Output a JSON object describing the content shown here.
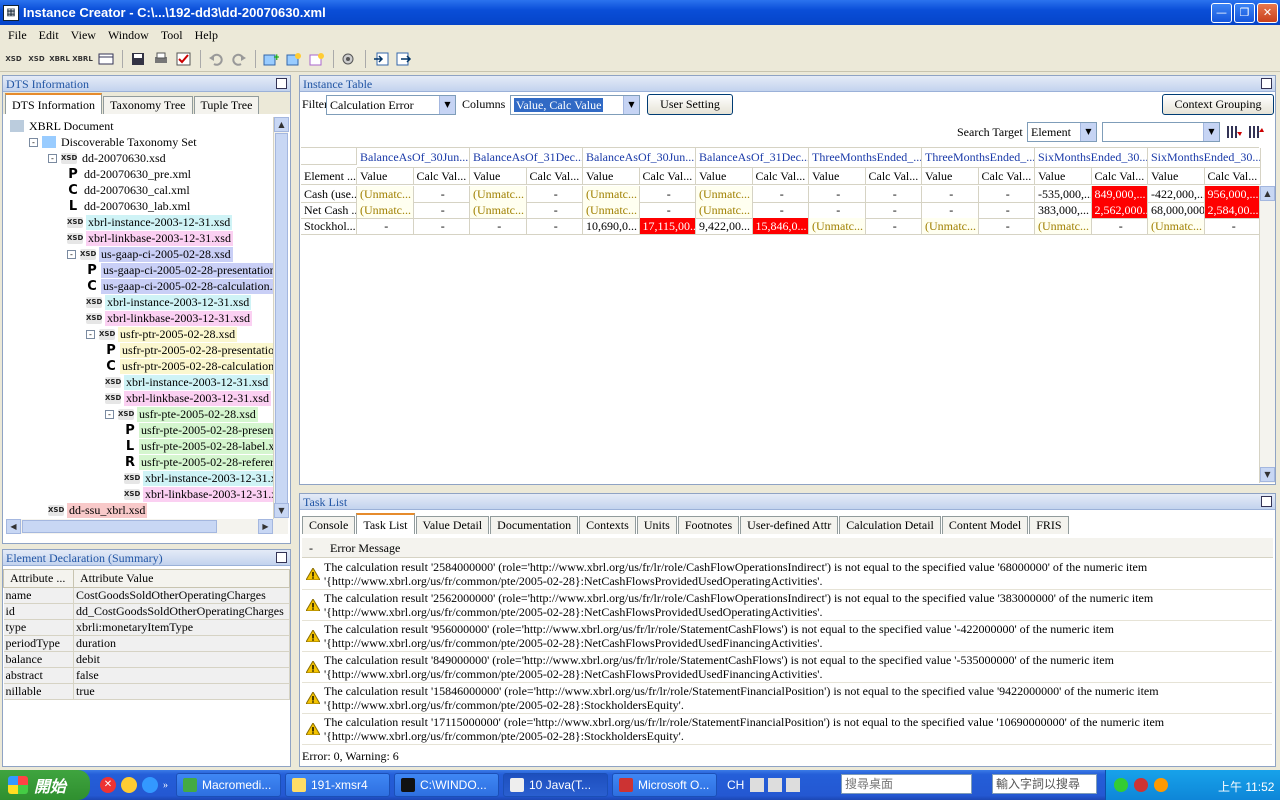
{
  "window": {
    "title": "Instance Creator - C:\\...\\192-dd3\\dd-20070630.xml"
  },
  "menu": [
    "File",
    "Edit",
    "View",
    "Window",
    "Tool",
    "Help"
  ],
  "toolbar_icons": [
    "XSD",
    "XSD",
    "XBRL",
    "XBRL"
  ],
  "dts": {
    "panel_title": "DTS Information",
    "tabs": [
      "DTS Information",
      "Taxonomy Tree",
      "Tuple Tree"
    ],
    "tree": [
      {
        "label": "XBRL Document",
        "icon": "xbrl-doc-icon",
        "level": 0,
        "exp": ""
      },
      {
        "label": "Discoverable Taxonomy Set",
        "icon": "taxonomy-set-icon",
        "level": 1,
        "exp": "-"
      },
      {
        "label": "dd-20070630.xsd",
        "icon": "xsd",
        "level": 2,
        "exp": "-"
      },
      {
        "label": "dd-20070630_pre.xml",
        "icon": "P",
        "level": 3,
        "exp": ""
      },
      {
        "label": "dd-20070630_cal.xml",
        "icon": "C",
        "level": 3,
        "exp": ""
      },
      {
        "label": "dd-20070630_lab.xml",
        "icon": "L",
        "level": 3,
        "exp": ""
      },
      {
        "label": "xbrl-instance-2003-12-31.xsd",
        "icon": "xsd",
        "level": 3,
        "exp": "",
        "bg": "#cff3f6"
      },
      {
        "label": "xbrl-linkbase-2003-12-31.xsd",
        "icon": "xsd",
        "level": 3,
        "exp": "",
        "bg": "#fbd0f2"
      },
      {
        "label": "us-gaap-ci-2005-02-28.xsd",
        "icon": "xsd",
        "level": 3,
        "exp": "-",
        "bg": "#c9cff6"
      },
      {
        "label": "us-gaap-ci-2005-02-28-presentation",
        "icon": "P",
        "level": 4,
        "exp": "",
        "bg": "#c9cff6"
      },
      {
        "label": "us-gaap-ci-2005-02-28-calculation.x",
        "icon": "C",
        "level": 4,
        "exp": "",
        "bg": "#c9cff6"
      },
      {
        "label": "xbrl-instance-2003-12-31.xsd",
        "icon": "xsd",
        "level": 4,
        "exp": "",
        "bg": "#cff3f6"
      },
      {
        "label": "xbrl-linkbase-2003-12-31.xsd",
        "icon": "xsd",
        "level": 4,
        "exp": "",
        "bg": "#fbd0f2"
      },
      {
        "label": "usfr-ptr-2005-02-28.xsd",
        "icon": "xsd",
        "level": 4,
        "exp": "-",
        "bg": "#fbf7cf"
      },
      {
        "label": "usfr-ptr-2005-02-28-presentatio",
        "icon": "P",
        "level": 5,
        "exp": "",
        "bg": "#fbf7cf"
      },
      {
        "label": "usfr-ptr-2005-02-28-calculation",
        "icon": "C",
        "level": 5,
        "exp": "",
        "bg": "#fbf7cf"
      },
      {
        "label": "xbrl-instance-2003-12-31.xsd",
        "icon": "xsd",
        "level": 5,
        "exp": "",
        "bg": "#cff3f6"
      },
      {
        "label": "xbrl-linkbase-2003-12-31.xsd",
        "icon": "xsd",
        "level": 5,
        "exp": "",
        "bg": "#fbd0f2"
      },
      {
        "label": "usfr-pte-2005-02-28.xsd",
        "icon": "xsd",
        "level": 5,
        "exp": "-",
        "bg": "#d5f6cf"
      },
      {
        "label": "usfr-pte-2005-02-28-presen",
        "icon": "P",
        "level": 6,
        "exp": "",
        "bg": "#d5f6cf"
      },
      {
        "label": "usfr-pte-2005-02-28-label.x",
        "icon": "L",
        "level": 6,
        "exp": "",
        "bg": "#d5f6cf"
      },
      {
        "label": "usfr-pte-2005-02-28-referer",
        "icon": "R",
        "level": 6,
        "exp": "",
        "bg": "#d5f6cf"
      },
      {
        "label": "xbrl-instance-2003-12-31.xs",
        "icon": "xsd",
        "level": 6,
        "exp": "",
        "bg": "#cff3f6"
      },
      {
        "label": "xbrl-linkbase-2003-12-31.xs",
        "icon": "xsd",
        "level": 6,
        "exp": "",
        "bg": "#fbd0f2"
      },
      {
        "label": "dd-ssu_xbrl.xsd",
        "icon": "xsd",
        "level": 2,
        "exp": "",
        "bg": "#f8c9c9"
      }
    ]
  },
  "element_decl": {
    "panel_title": "Element Declaration (Summary)",
    "headers": [
      "Attribute ...",
      "Attribute Value"
    ],
    "rows": [
      [
        "name",
        "CostGoodsSoldOtherOperatingCharges"
      ],
      [
        "id",
        "dd_CostGoodsSoldOtherOperatingCharges"
      ],
      [
        "type",
        "xbrli:monetaryItemType"
      ],
      [
        "periodType",
        "duration"
      ],
      [
        "balance",
        "debit"
      ],
      [
        "abstract",
        "false"
      ],
      [
        "nillable",
        "true"
      ]
    ]
  },
  "instance": {
    "panel_title": "Instance Table",
    "filter_label": "Filter",
    "filter_value": "Calculation Error",
    "columns_label": "Columns",
    "columns_value": "Value, Calc Value",
    "user_setting": "User Setting",
    "context_grouping": "Context Grouping",
    "search_target_label": "Search Target",
    "search_target_value": "Element",
    "search_value": "",
    "context_headers": [
      "BalanceAsOf_30Jun...",
      "BalanceAsOf_31Dec...",
      "BalanceAsOf_30Jun...",
      "BalanceAsOf_31Dec...",
      "ThreeMonthsEnded_...",
      "ThreeMonthsEnded_...",
      "SixMonthsEnded_30...",
      "SixMonthsEnded_30..."
    ],
    "element_header": "Element ...",
    "sub_headers": [
      "Value",
      "Calc Val..."
    ],
    "rows": [
      {
        "label": "Cash (use...",
        "cells": [
          [
            "(Unmatc...",
            "u"
          ],
          [
            "-",
            ""
          ],
          [
            "(Unmatc...",
            "u"
          ],
          [
            "-",
            ""
          ],
          [
            "(Unmatc...",
            "u"
          ],
          [
            "-",
            ""
          ],
          [
            "(Unmatc...",
            "u"
          ],
          [
            "-",
            ""
          ],
          [
            "-",
            ""
          ],
          [
            "-",
            ""
          ],
          [
            "-",
            ""
          ],
          [
            "-",
            ""
          ],
          [
            "-535,000,...",
            ""
          ],
          [
            "849,000,...",
            "r"
          ],
          [
            "-422,000,...",
            ""
          ],
          [
            "956,000,...",
            "r"
          ]
        ]
      },
      {
        "label": "Net Cash ...",
        "cells": [
          [
            "(Unmatc...",
            "u"
          ],
          [
            "-",
            ""
          ],
          [
            "(Unmatc...",
            "u"
          ],
          [
            "-",
            ""
          ],
          [
            "(Unmatc...",
            "u"
          ],
          [
            "-",
            ""
          ],
          [
            "(Unmatc...",
            "u"
          ],
          [
            "-",
            ""
          ],
          [
            "-",
            ""
          ],
          [
            "-",
            ""
          ],
          [
            "-",
            ""
          ],
          [
            "-",
            ""
          ],
          [
            "383,000,...",
            ""
          ],
          [
            "2,562,000...",
            "r"
          ],
          [
            "68,000,000",
            ""
          ],
          [
            "2,584,00...",
            "r"
          ]
        ]
      },
      {
        "label": "Stockhol...",
        "cells": [
          [
            "-",
            ""
          ],
          [
            "-",
            ""
          ],
          [
            "-",
            ""
          ],
          [
            "-",
            ""
          ],
          [
            "10,690,0...",
            ""
          ],
          [
            "17,115,00...",
            "r"
          ],
          [
            "9,422,00...",
            ""
          ],
          [
            "15,846,0...",
            "r"
          ],
          [
            "(Unmatc...",
            "u"
          ],
          [
            "-",
            ""
          ],
          [
            "(Unmatc...",
            "u"
          ],
          [
            "-",
            ""
          ],
          [
            "(Unmatc...",
            "u"
          ],
          [
            "-",
            ""
          ],
          [
            "(Unmatc...",
            "u"
          ],
          [
            "-",
            ""
          ]
        ]
      }
    ]
  },
  "task": {
    "panel_title": "Task List",
    "tabs": [
      "Console",
      "Task List",
      "Value Detail",
      "Documentation",
      "Contexts",
      "Units",
      "Footnotes",
      "User-defined Attr",
      "Calculation Detail",
      "Content Model",
      "FRIS"
    ],
    "col_dash": "-",
    "col_msg": "Error Message",
    "messages": [
      "The calculation result '2584000000' (role='http://www.xbrl.org/us/fr/lr/role/CashFlowOperationsIndirect') is not equal to the specified value '68000000' of the numeric item '{http://www.xbrl.org/us/fr/common/pte/2005-02-28}:NetCashFlowsProvidedUsedOperatingActivities'.",
      "The calculation result '2562000000' (role='http://www.xbrl.org/us/fr/lr/role/CashFlowOperationsIndirect') is not equal to the specified value '383000000' of the numeric item '{http://www.xbrl.org/us/fr/common/pte/2005-02-28}:NetCashFlowsProvidedUsedOperatingActivities'.",
      "The calculation result '956000000' (role='http://www.xbrl.org/us/fr/lr/role/StatementCashFlows') is not equal to the specified value '-422000000' of the numeric item '{http://www.xbrl.org/us/fr/common/pte/2005-02-28}:NetCashFlowsProvidedUsedFinancingActivities'.",
      "The calculation result '849000000' (role='http://www.xbrl.org/us/fr/lr/role/StatementCashFlows') is not equal to the specified value '-535000000' of the numeric item '{http://www.xbrl.org/us/fr/common/pte/2005-02-28}:NetCashFlowsProvidedUsedFinancingActivities'.",
      "The calculation result '15846000000' (role='http://www.xbrl.org/us/fr/lr/role/StatementFinancialPosition') is not equal to the specified value '9422000000' of the numeric item '{http://www.xbrl.org/us/fr/common/pte/2005-02-28}:StockholdersEquity'.",
      "The calculation result '17115000000' (role='http://www.xbrl.org/us/fr/lr/role/StatementFinancialPosition') is not equal to the specified value '10690000000' of the numeric item '{http://www.xbrl.org/us/fr/common/pte/2005-02-28}:StockholdersEquity'."
    ],
    "status": "Error: 0, Warning: 6"
  },
  "taskbar": {
    "start": "開始",
    "tasks": [
      "Macromedi...",
      "191-xmsr4",
      "C:\\WINDO...",
      "10 Java(T...",
      "Microsoft O..."
    ],
    "lang": "CH",
    "search_placeholder": "搜尋桌面",
    "ime_placeholder": "輸入字詞以搜尋",
    "clock": "上午 11:52"
  },
  "colors": {
    "unmatched_bg": "#fffff0",
    "error_bg": "#ff0000",
    "title_blue": "#0a4ed8"
  }
}
